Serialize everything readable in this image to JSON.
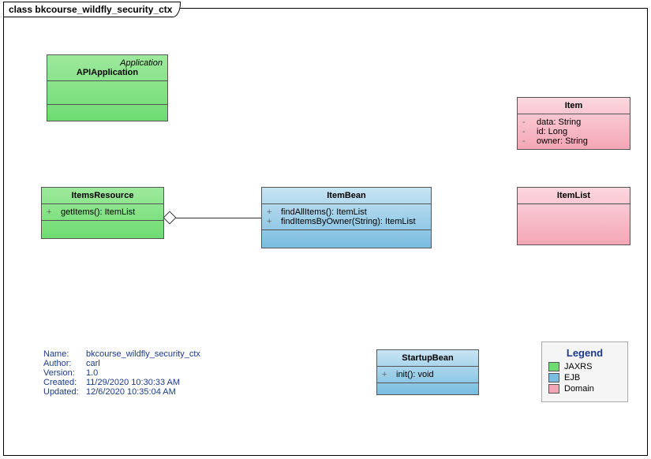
{
  "frame": {
    "title": "class bkcourse_wildfly_security_ctx"
  },
  "classes": {
    "api": {
      "stereotype": "Application",
      "name": "APIApplication"
    },
    "itemsResource": {
      "name": "ItemsResource",
      "ops": [
        {
          "vis": "+",
          "sig": "getItems(): ItemList"
        }
      ]
    },
    "itemBean": {
      "name": "ItemBean",
      "ops": [
        {
          "vis": "+",
          "sig": "findAllItems(): ItemList"
        },
        {
          "vis": "+",
          "sig": "findItemsByOwner(String): ItemList"
        }
      ]
    },
    "item": {
      "name": "Item",
      "attrs": [
        {
          "vis": "-",
          "sig": "data: String"
        },
        {
          "vis": "-",
          "sig": "id: Long"
        },
        {
          "vis": "-",
          "sig": "owner: String"
        }
      ]
    },
    "itemList": {
      "name": "ItemList"
    },
    "startupBean": {
      "name": "StartupBean",
      "ops": [
        {
          "vis": "+",
          "sig": "init(): void"
        }
      ]
    }
  },
  "meta": {
    "name_k": "Name:",
    "name_v": "bkcourse_wildfly_security_ctx",
    "author_k": "Author:",
    "author_v": "carl",
    "version_k": "Version:",
    "version_v": "1.0",
    "created_k": "Created:",
    "created_v": "11/29/2020 10:30:33 AM",
    "updated_k": "Updated:",
    "updated_v": "12/6/2020 10:35:04 AM"
  },
  "legend": {
    "title": "Legend",
    "items": [
      {
        "label": "JAXRS",
        "class": "jaxrs"
      },
      {
        "label": "EJB",
        "class": "ejb"
      },
      {
        "label": "Domain",
        "class": "domain"
      }
    ]
  },
  "chart_data": {
    "type": "uml-class-diagram",
    "frame": "class bkcourse_wildfly_security_ctx",
    "classes": [
      {
        "id": "APIApplication",
        "stereotype": "Application",
        "category": "JAXRS",
        "attributes": [],
        "operations": []
      },
      {
        "id": "ItemsResource",
        "category": "JAXRS",
        "attributes": [],
        "operations": [
          {
            "visibility": "+",
            "name": "getItems",
            "params": [],
            "returns": "ItemList"
          }
        ]
      },
      {
        "id": "ItemBean",
        "category": "EJB",
        "attributes": [],
        "operations": [
          {
            "visibility": "+",
            "name": "findAllItems",
            "params": [],
            "returns": "ItemList"
          },
          {
            "visibility": "+",
            "name": "findItemsByOwner",
            "params": [
              "String"
            ],
            "returns": "ItemList"
          }
        ]
      },
      {
        "id": "StartupBean",
        "category": "EJB",
        "attributes": [],
        "operations": [
          {
            "visibility": "+",
            "name": "init",
            "params": [],
            "returns": "void"
          }
        ]
      },
      {
        "id": "Item",
        "category": "Domain",
        "operations": [],
        "attributes": [
          {
            "visibility": "-",
            "name": "data",
            "type": "String"
          },
          {
            "visibility": "-",
            "name": "id",
            "type": "Long"
          },
          {
            "visibility": "-",
            "name": "owner",
            "type": "String"
          }
        ]
      },
      {
        "id": "ItemList",
        "category": "Domain",
        "attributes": [],
        "operations": []
      }
    ],
    "relations": [
      {
        "from": "ItemsResource",
        "to": "ItemBean",
        "type": "aggregation",
        "diamond_at": "ItemsResource"
      }
    ],
    "legend": [
      "JAXRS",
      "EJB",
      "Domain"
    ],
    "metadata": {
      "Name": "bkcourse_wildfly_security_ctx",
      "Author": "carl",
      "Version": "1.0",
      "Created": "11/29/2020 10:30:33 AM",
      "Updated": "12/6/2020 10:35:04 AM"
    }
  }
}
